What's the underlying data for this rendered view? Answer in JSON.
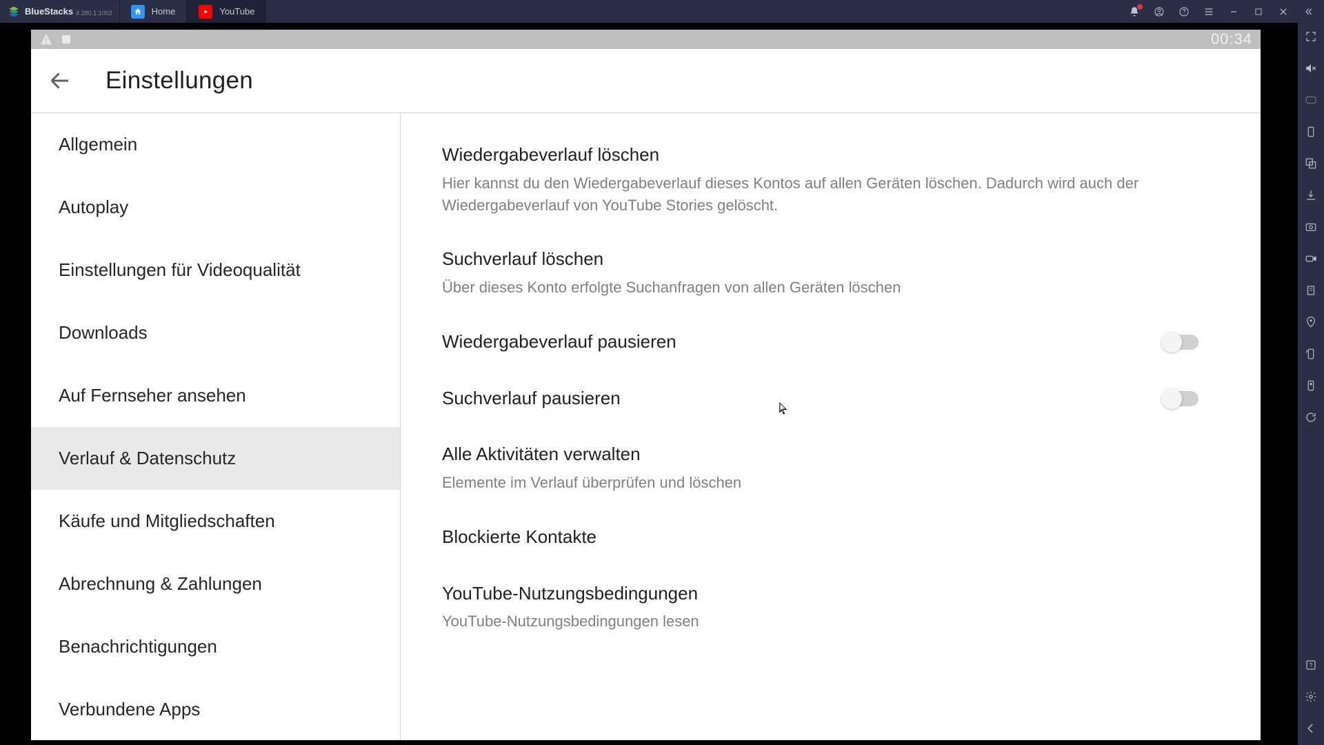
{
  "brand": {
    "name": "BlueStacks",
    "version": "4.280.1.1002"
  },
  "tabs": [
    {
      "label": "Home"
    },
    {
      "label": "YouTube"
    }
  ],
  "status": {
    "time": "00:34"
  },
  "header": {
    "title": "Einstellungen"
  },
  "nav": {
    "items": [
      "Allgemein",
      "Autoplay",
      "Einstellungen für Videoqualität",
      "Downloads",
      "Auf Fernseher ansehen",
      "Verlauf & Datenschutz",
      "Käufe und Mitgliedschaften",
      "Abrechnung & Zahlungen",
      "Benachrichtigungen",
      "Verbundene Apps"
    ],
    "active_index": 5
  },
  "content": {
    "clear_history": {
      "title": "Wiedergabeverlauf löschen",
      "desc": "Hier kannst du den Wiedergabeverlauf dieses Kontos auf allen Geräten löschen. Dadurch wird auch der Wiedergabeverlauf von YouTube Stories gelöscht."
    },
    "clear_search": {
      "title": "Suchverlauf löschen",
      "desc": "Über dieses Konto erfolgte Suchanfragen von allen Geräten löschen"
    },
    "pause_history": {
      "title": "Wiedergabeverlauf pausieren",
      "enabled": false
    },
    "pause_search": {
      "title": "Suchverlauf pausieren",
      "enabled": false
    },
    "manage_activity": {
      "title": "Alle Aktivitäten verwalten",
      "desc": "Elemente im Verlauf überprüfen und löschen"
    },
    "blocked": {
      "title": "Blockierte Kontakte"
    },
    "terms": {
      "title": "YouTube-Nutzungsbedingungen",
      "desc": "YouTube-Nutzungsbedingungen lesen"
    }
  }
}
